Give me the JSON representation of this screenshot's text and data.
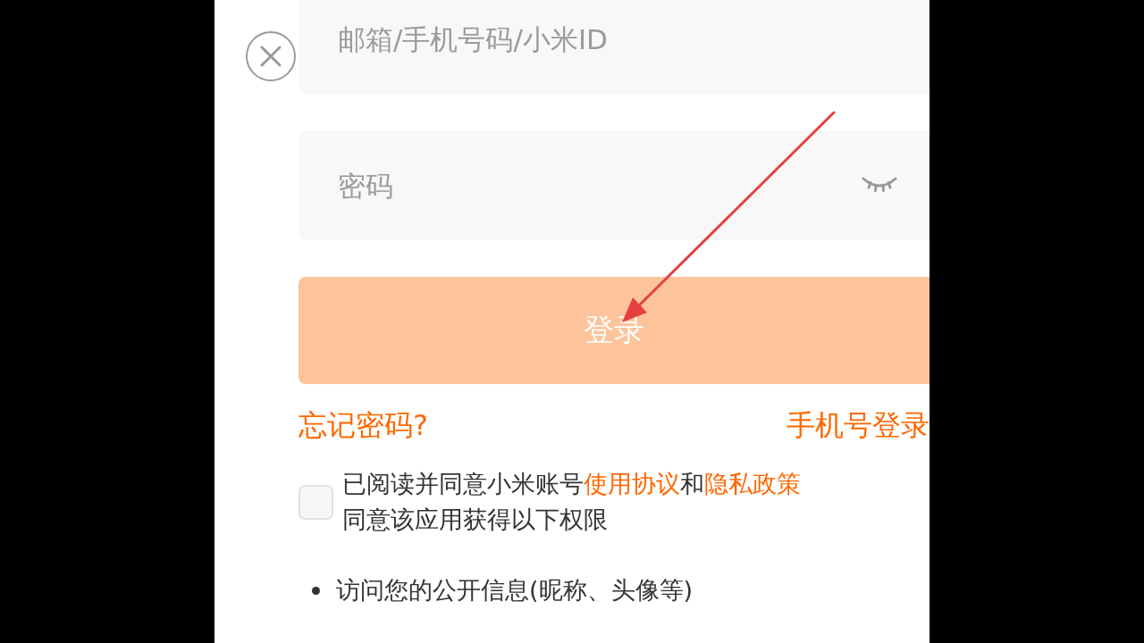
{
  "account_field": {
    "placeholder": "邮箱/手机号码/小米ID"
  },
  "password_field": {
    "placeholder": "密码",
    "password_visible": false
  },
  "login_button": {
    "label": "登录",
    "disabled": true
  },
  "links": {
    "forgot_password": "忘记密码?",
    "phone_login": "手机号登录"
  },
  "agreement": {
    "checked": false,
    "segments": [
      {
        "kind": "text",
        "text": "已阅读并同意小米账号"
      },
      {
        "kind": "link",
        "text": "使用协议"
      },
      {
        "kind": "text",
        "text": "和"
      },
      {
        "kind": "link",
        "text": "隐私政策"
      }
    ],
    "note": "同意该应用获得以下权限"
  },
  "permissions": [
    "访问您的公开信息(昵称、头像等)"
  ],
  "annotations": [
    {
      "kind": "arrow"
    }
  ]
}
